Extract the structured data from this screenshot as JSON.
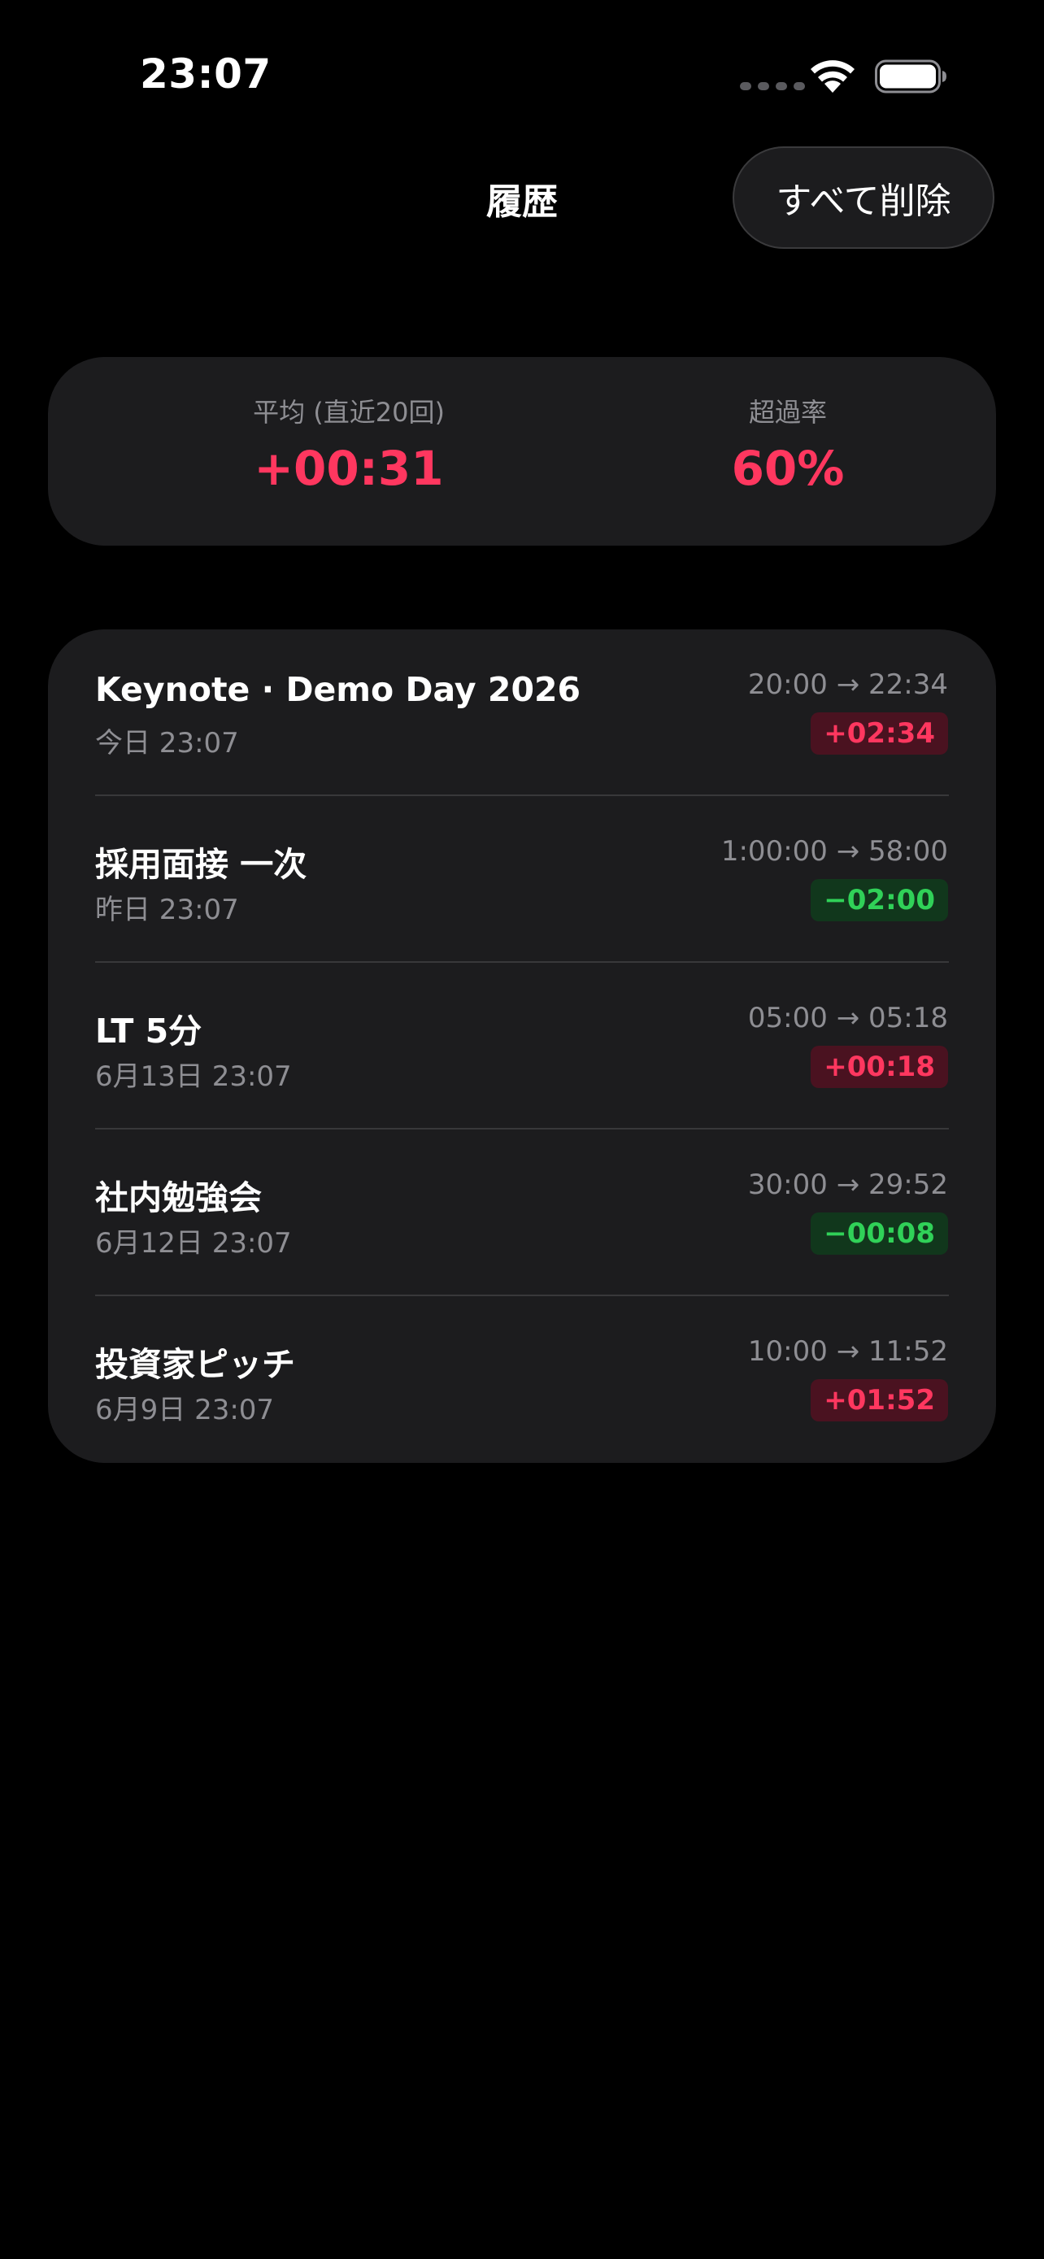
{
  "status_bar": {
    "time": "23:07",
    "icons": [
      "signal-icon",
      "wifi-icon",
      "battery-icon"
    ]
  },
  "nav": {
    "title": "履歴",
    "delete_all_label": "すべて削除"
  },
  "summary": {
    "average_label": "平均 (直近20回)",
    "average_value": "+00:31",
    "overrun_label": "超過率",
    "overrun_value": "60%"
  },
  "history": [
    {
      "title": "Keynote · Demo Day 2026",
      "date": "今日 23:07",
      "times": "20:00 → 22:34",
      "diff": "+02:34",
      "status": "over"
    },
    {
      "title": "採用面接 一次",
      "date": "昨日 23:07",
      "times": "1:00:00 → 58:00",
      "diff": "−02:00",
      "status": "under"
    },
    {
      "title": "LT 5分",
      "date": "6月13日 23:07",
      "times": "05:00 → 05:18",
      "diff": "+00:18",
      "status": "over"
    },
    {
      "title": "社内勉強会",
      "date": "6月12日 23:07",
      "times": "30:00 → 29:52",
      "diff": "−00:08",
      "status": "under"
    },
    {
      "title": "投資家ピッチ",
      "date": "6月9日 23:07",
      "times": "10:00 → 11:52",
      "diff": "+01:52",
      "status": "over"
    }
  ],
  "colors": {
    "background": "#000000",
    "card": "#1c1c1e",
    "over": "#ff375f",
    "under": "#30d158",
    "secondary_text": "#8e8e93"
  }
}
